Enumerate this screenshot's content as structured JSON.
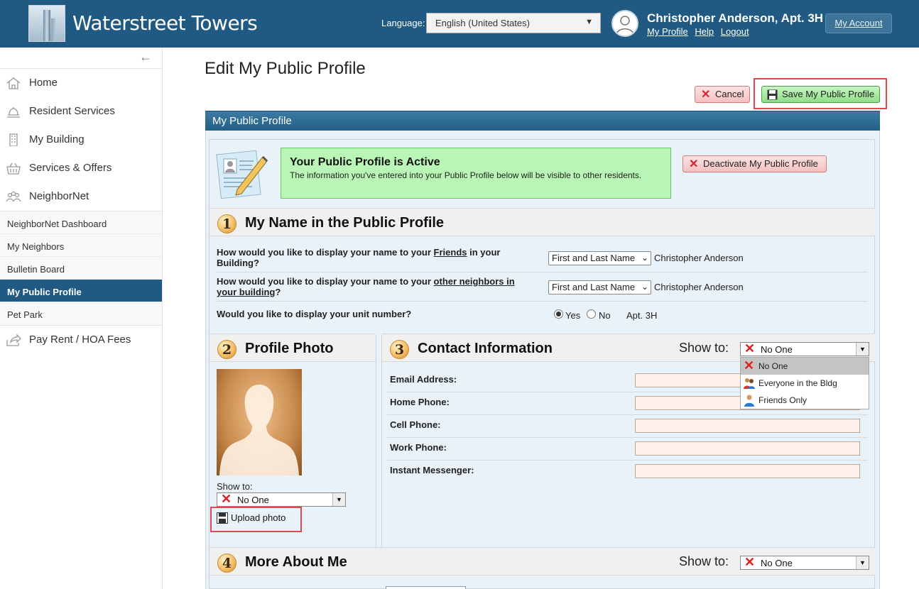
{
  "header": {
    "brand": "Waterstreet Towers",
    "language_label": "Language:",
    "language_value": "English (United States)",
    "user_name": "Christopher Anderson, Apt. 3H",
    "links": {
      "profile": "My Profile",
      "help": "Help",
      "logout": "Logout"
    },
    "my_account": "My Account"
  },
  "sidebar": {
    "collapse_icon": "arrow-left-icon",
    "items": [
      {
        "label": "Home",
        "icon": "home-icon"
      },
      {
        "label": "Resident Services",
        "icon": "bell-icon"
      },
      {
        "label": "My Building",
        "icon": "building-icon"
      },
      {
        "label": "Services & Offers",
        "icon": "basket-icon"
      },
      {
        "label": "NeighborNet",
        "icon": "people-icon"
      }
    ],
    "sub_items": [
      {
        "label": "NeighborNet Dashboard"
      },
      {
        "label": "My Neighbors"
      },
      {
        "label": "Bulletin Board"
      },
      {
        "label": "My Public Profile",
        "active": true
      },
      {
        "label": "Pet Park"
      }
    ],
    "last_item": {
      "label": "Pay Rent / HOA Fees",
      "icon": "share-icon"
    }
  },
  "main": {
    "title": "Edit My Public Profile",
    "cancel": "Cancel",
    "save": "Save My Public Profile",
    "panel_title": "My Public Profile",
    "active_title": "Your Public Profile is Active",
    "active_desc": "The information you've entered into your Public Profile below will be visible to other residents.",
    "deactivate": "Deactivate My Public Profile"
  },
  "section1": {
    "number": "1",
    "title": "My Name in the Public Profile",
    "q1_pre": "How would you like to display your name to your ",
    "q1_link": "Friends",
    "q1_post": " in your Building?",
    "q1_select": "First and Last Name",
    "q1_value": "Christopher Anderson",
    "q2_pre": "How would you like to display your name to your ",
    "q2_link": "other neighbors in your building",
    "q2_post": "?",
    "q2_select": "First and Last Name",
    "q2_value": "Christopher Anderson",
    "q3": "Would you like to display your unit number?",
    "yes": "Yes",
    "no": "No",
    "unit": "Apt. 3H"
  },
  "section2": {
    "number": "2",
    "title": "Profile Photo",
    "show_to_label": "Show to:",
    "show_to_value": "No One",
    "upload": "Upload photo"
  },
  "section3": {
    "number": "3",
    "title": "Contact Information",
    "show_to_label": "Show to:",
    "show_to_value": "No One",
    "fields": [
      {
        "label": "Email Address:"
      },
      {
        "label": "Home Phone:"
      },
      {
        "label": "Cell Phone:"
      },
      {
        "label": "Work Phone:"
      },
      {
        "label": "Instant Messenger:"
      }
    ],
    "menu_options": [
      "No One",
      "Everyone in the Bldg",
      "Friends Only"
    ]
  },
  "section4": {
    "number": "4",
    "title": "More About Me",
    "show_to_label": "Show to:",
    "show_to_value": "No One"
  },
  "colors": {
    "header_bg": "#205a82",
    "active_nav": "#205a82",
    "active_box": "#b9f5b4",
    "highlight": "#e2464e"
  }
}
